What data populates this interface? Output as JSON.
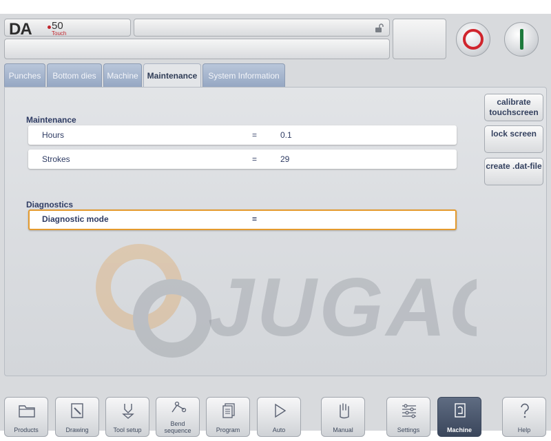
{
  "header": {
    "logo_main": "DA",
    "logo_model": "50",
    "logo_sub": "Touch",
    "title": "",
    "message": "",
    "status": ""
  },
  "tabs": [
    {
      "label": "Punches",
      "active": false
    },
    {
      "label": "Bottom dies",
      "active": false
    },
    {
      "label": "Machine",
      "active": false
    },
    {
      "label": "Maintenance",
      "active": true
    },
    {
      "label": "System Information",
      "active": false
    }
  ],
  "maintenance": {
    "section_title": "Maintenance",
    "rows": [
      {
        "label": "Hours",
        "eq": "=",
        "value": "0.1"
      },
      {
        "label": "Strokes",
        "eq": "=",
        "value": "29"
      }
    ]
  },
  "diagnostics": {
    "section_title": "Diagnostics",
    "rows": [
      {
        "label": "Diagnostic mode",
        "eq": "=",
        "value": ""
      }
    ]
  },
  "side_buttons": {
    "calibrate": "calibrate touchscreen",
    "lock": "lock screen",
    "create": "create .dat-file"
  },
  "watermark": "JUGAO",
  "toolbar": [
    {
      "label": "Products",
      "icon": "folder-icon"
    },
    {
      "label": "Drawing",
      "icon": "drawing-icon"
    },
    {
      "label": "Tool setup",
      "icon": "tool-setup-icon"
    },
    {
      "label": "Bend sequence",
      "icon": "bend-sequence-icon"
    },
    {
      "label": "Program",
      "icon": "program-icon"
    },
    {
      "label": "Auto",
      "icon": "play-icon"
    },
    {
      "label": "Manual",
      "icon": "hand-icon"
    },
    {
      "label": "Settings",
      "icon": "settings-icon"
    },
    {
      "label": "Machine",
      "icon": "machine-icon",
      "active": true
    },
    {
      "label": "Help",
      "icon": "help-icon"
    }
  ],
  "colors": {
    "accent_focus": "#e49a2d",
    "stop": "#d0252d",
    "start": "#1e7a3c",
    "tab_inactive": "#95a7c3",
    "text_primary": "#2e3b63"
  }
}
